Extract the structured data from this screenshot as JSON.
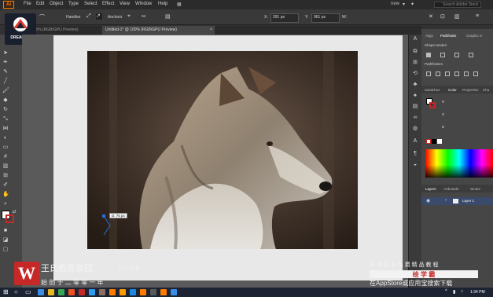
{
  "menu": {
    "items": [
      "File",
      "Edit",
      "Object",
      "Type",
      "Select",
      "Effect",
      "View",
      "Window",
      "Help"
    ],
    "workspace": "new",
    "search_placeholder": "Search Adobe Stock"
  },
  "control_bar": {
    "handles_label": "Handles",
    "anchors_label": "Anchors",
    "x_label": "X:",
    "x_value": "391 px",
    "y_label": "Y:",
    "y_value": "961 px",
    "w_label": "W:"
  },
  "tabs": [
    {
      "label": "...@ 25% (RGB/GPU Preview)",
      "active": false
    },
    {
      "label": "Untitled-1* @ 100% (RGB/GPU Preview)",
      "active": true
    }
  ],
  "logo": {
    "name": "DREAMER"
  },
  "tooltip": {
    "value": "D: 75 px"
  },
  "panels": {
    "top_tabs": [
      "Align",
      "Pathfinder",
      "Graphic S"
    ],
    "shape_modes_label": "Shape Modes:",
    "pathfinders_label": "Pathfinders:",
    "mid_tabs": [
      "Swatches",
      "Color",
      "Properties",
      "Cha"
    ],
    "color_channels": [
      "R",
      "G",
      "B"
    ],
    "bottom_tabs": [
      "Layers",
      "Artboards",
      "Stroke"
    ],
    "layer_name": "Layer 1"
  },
  "watermark": {
    "company": "王氏教育集团",
    "slogan": "以人为本",
    "motto": "始 创 于 二 零 零 一 年",
    "right_line1": "获 得 更 多 免 费 精 品 教 程",
    "badge": "绘 学 霸",
    "right_line2": "在AppStore或应用宝搜索下载"
  },
  "taskbar": {
    "clock": "1:34 PM",
    "icon_colors": [
      "#3a8ee6",
      "#e8b923",
      "#34a853",
      "#f04e23",
      "#c62828",
      "#2d9bf0",
      "#8d6e63",
      "#ff7c00",
      "#ff9a00",
      "#1e88e5",
      "#ff7c00",
      "#5a5a5a",
      "#ff7c00",
      "#3a8ee6"
    ]
  },
  "colors": {
    "accent": "#ff7c00",
    "layer_highlight": "#3a4a6b",
    "watermark_red": "#c62828"
  }
}
